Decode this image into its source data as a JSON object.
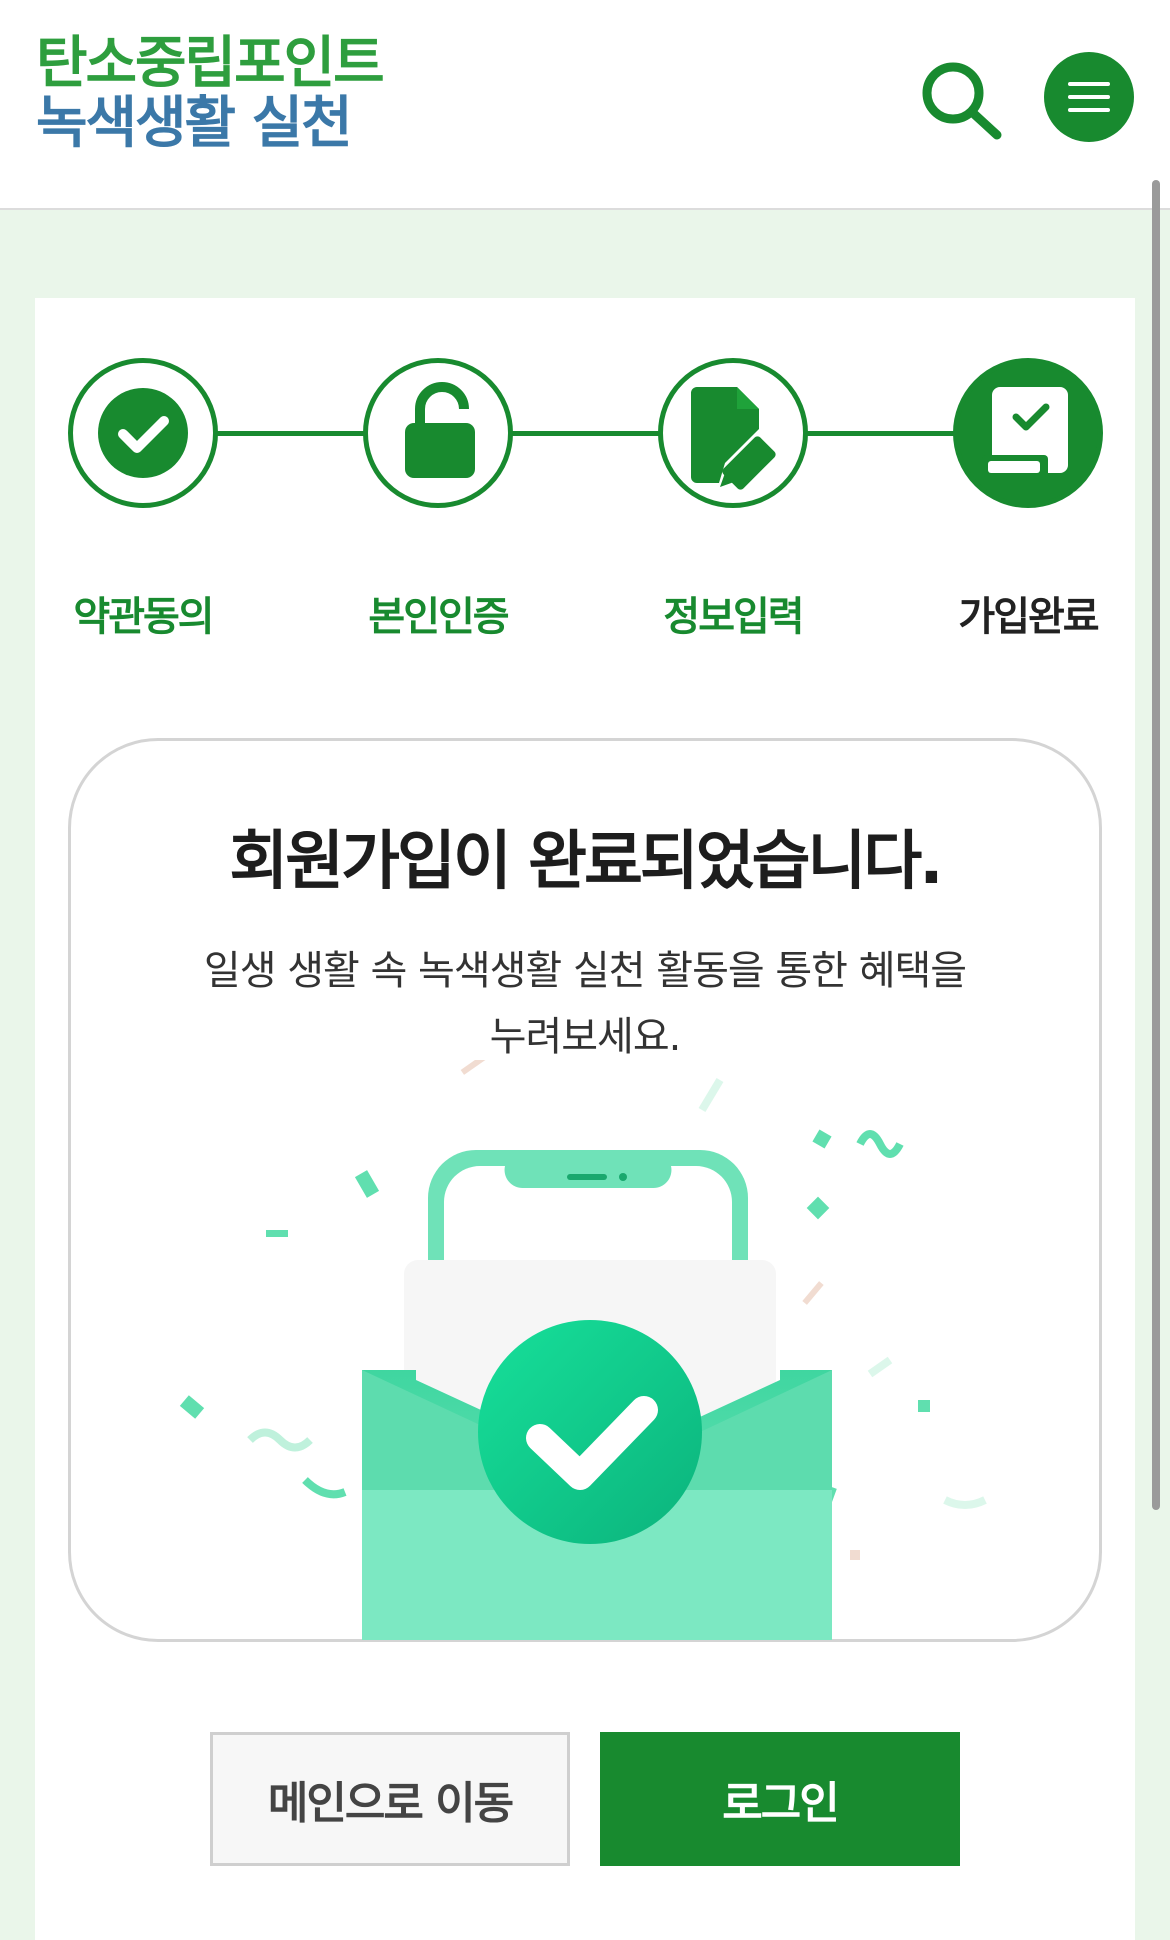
{
  "header": {
    "logo_line1": "탄소중립포인트",
    "logo_line2": "녹색생활 실천",
    "search_icon": "search-icon",
    "menu_icon": "hamburger-menu-icon"
  },
  "steps": [
    {
      "label": "약관동의",
      "icon": "check-circle-icon",
      "state": "done"
    },
    {
      "label": "본인인증",
      "icon": "unlock-icon",
      "state": "done"
    },
    {
      "label": "정보입력",
      "icon": "edit-document-icon",
      "state": "done"
    },
    {
      "label": "가입완료",
      "icon": "signup-complete-icon",
      "state": "current"
    }
  ],
  "complete": {
    "title": "회원가입이 완료되었습니다.",
    "description": "일생 생활 속 녹색생활 실천 활동을 통한 혜택을 누려보세요.",
    "illustration": "phone-envelope-check-illustration"
  },
  "buttons": {
    "main_label": "메인으로 이동",
    "login_label": "로그인"
  },
  "colors": {
    "primary": "#188a2f",
    "logo_green": "#2e9e3e",
    "logo_blue": "#3b78a8",
    "page_bg": "#eaf6ea",
    "mint": "#4fdca6"
  }
}
